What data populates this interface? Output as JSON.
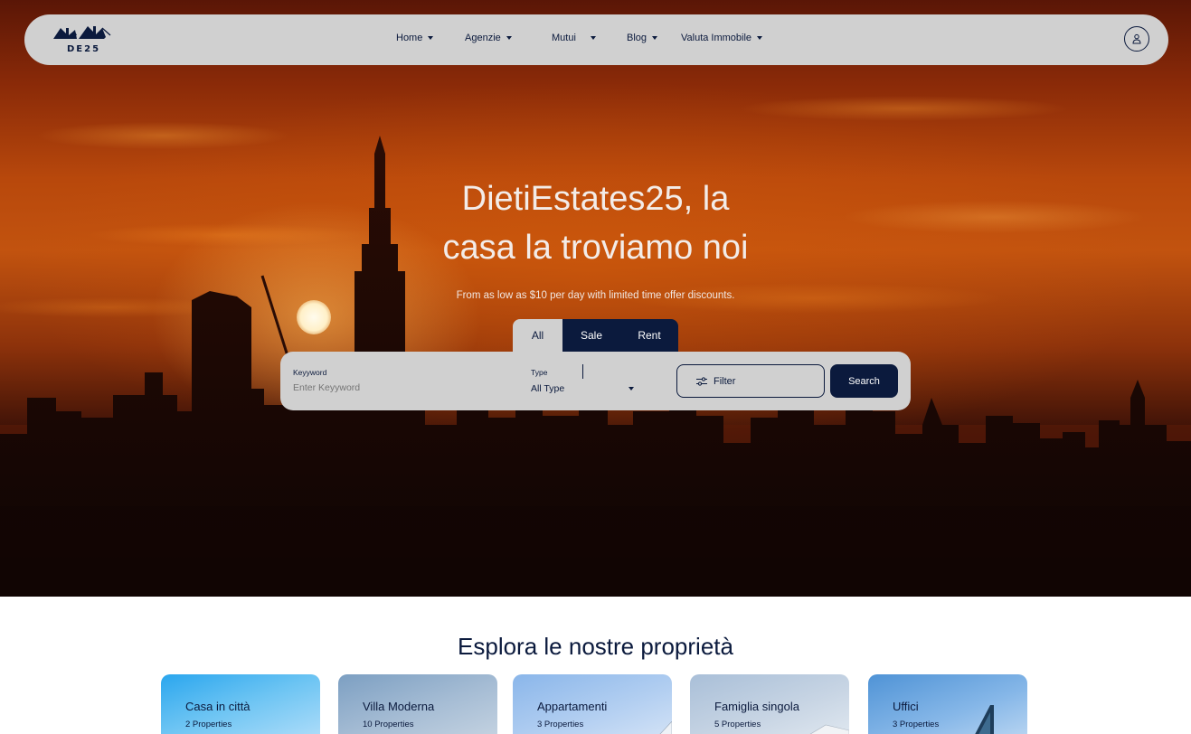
{
  "brand": {
    "logo_text": "DE25"
  },
  "nav": {
    "items": [
      {
        "label": "Home"
      },
      {
        "label": "Agenzie"
      },
      {
        "label": "Mutui"
      },
      {
        "label": "Blog"
      },
      {
        "label": "Valuta Immobile"
      }
    ]
  },
  "hero": {
    "title_line1": "DietiEstates25, la",
    "title_line2": "casa la troviamo noi",
    "subtitle": "From as low as $10 per day with limited time offer discounts."
  },
  "search": {
    "tabs": [
      {
        "label": "All",
        "active": true
      },
      {
        "label": "Sale",
        "active": false
      },
      {
        "label": "Rent",
        "active": false
      }
    ],
    "keyword_label": "Keyyword",
    "keyword_placeholder": "Enter Keyyword",
    "type_label": "Type",
    "type_value": "All Type",
    "filter_label": "Filter",
    "search_label": "Search"
  },
  "explore": {
    "title": "Esplora le nostre proprietà",
    "cards": [
      {
        "name": "Casa in città",
        "count": "2 Properties"
      },
      {
        "name": "Villa Moderna",
        "count": "10 Properties"
      },
      {
        "name": "Appartamenti",
        "count": "3 Properties"
      },
      {
        "name": "Famiglia singola",
        "count": "5 Properties"
      },
      {
        "name": "Uffici",
        "count": "3 Properties"
      }
    ]
  },
  "colors": {
    "navy": "#0b1a3d",
    "bar_gray": "#d0d0d0",
    "sunset_orange": "#c2530f"
  },
  "icons": {
    "user": "user-icon",
    "filter": "sliders-icon",
    "caret": "caret-down-icon"
  }
}
